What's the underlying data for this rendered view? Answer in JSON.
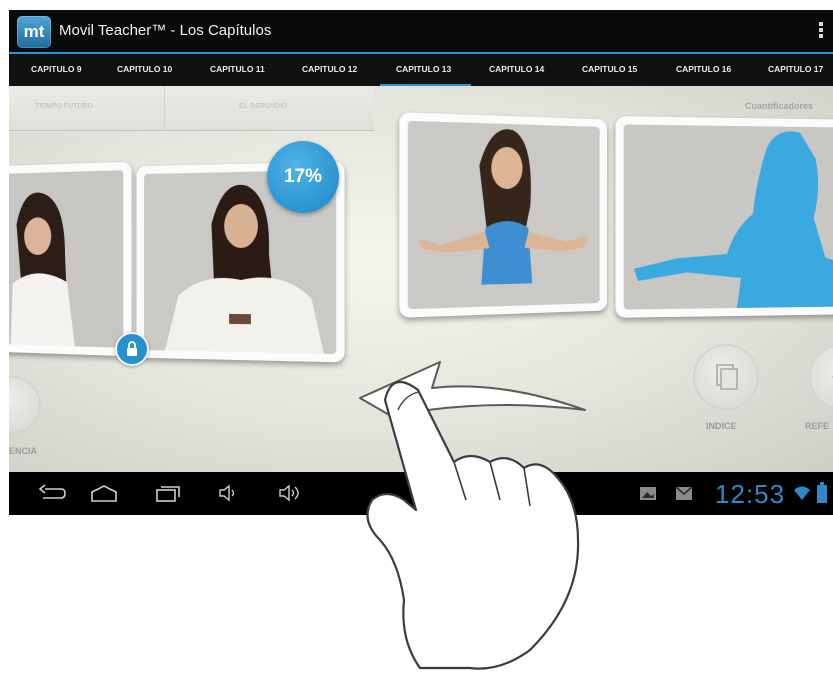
{
  "app": {
    "logo_text": "mt",
    "title": "Movil Teacher™ - Los Capítulos"
  },
  "tabs": [
    {
      "label": "CAPITULO 9"
    },
    {
      "label": "CAPITULO 10"
    },
    {
      "label": "CAPITULO 11"
    },
    {
      "label": "CAPITULO 12"
    },
    {
      "label": "CAPITULO 13",
      "selected": true
    },
    {
      "label": "CAPITULO 14"
    },
    {
      "label": "CAPITULO 15"
    },
    {
      "label": "CAPITULO 16"
    },
    {
      "label": "CAPITULO 17"
    }
  ],
  "subtabs": [
    {
      "label": "TIEMPO FUTURO"
    },
    {
      "label": "EL GERUNDIO"
    }
  ],
  "right_header": "Cuantificadores",
  "progress_badge": "17%",
  "actions": {
    "left_partial": "ENCIA",
    "indice": "INDICE",
    "right_partial": "REFE"
  },
  "status": {
    "time": "12:53"
  },
  "colors": {
    "accent": "#2b96d1",
    "silhouette": "#3aa9e0",
    "titlebar": "#0a0a0a"
  },
  "icons": [
    "menu-overflow-icon",
    "lock-icon",
    "index-icon",
    "reference-icon",
    "back-icon",
    "home-icon",
    "recent-apps-icon",
    "volume-down-icon",
    "volume-up-icon",
    "gallery-icon",
    "mail-icon",
    "wifi-icon",
    "battery-icon",
    "swipe-hand-icon",
    "swipe-arrow-icon"
  ]
}
